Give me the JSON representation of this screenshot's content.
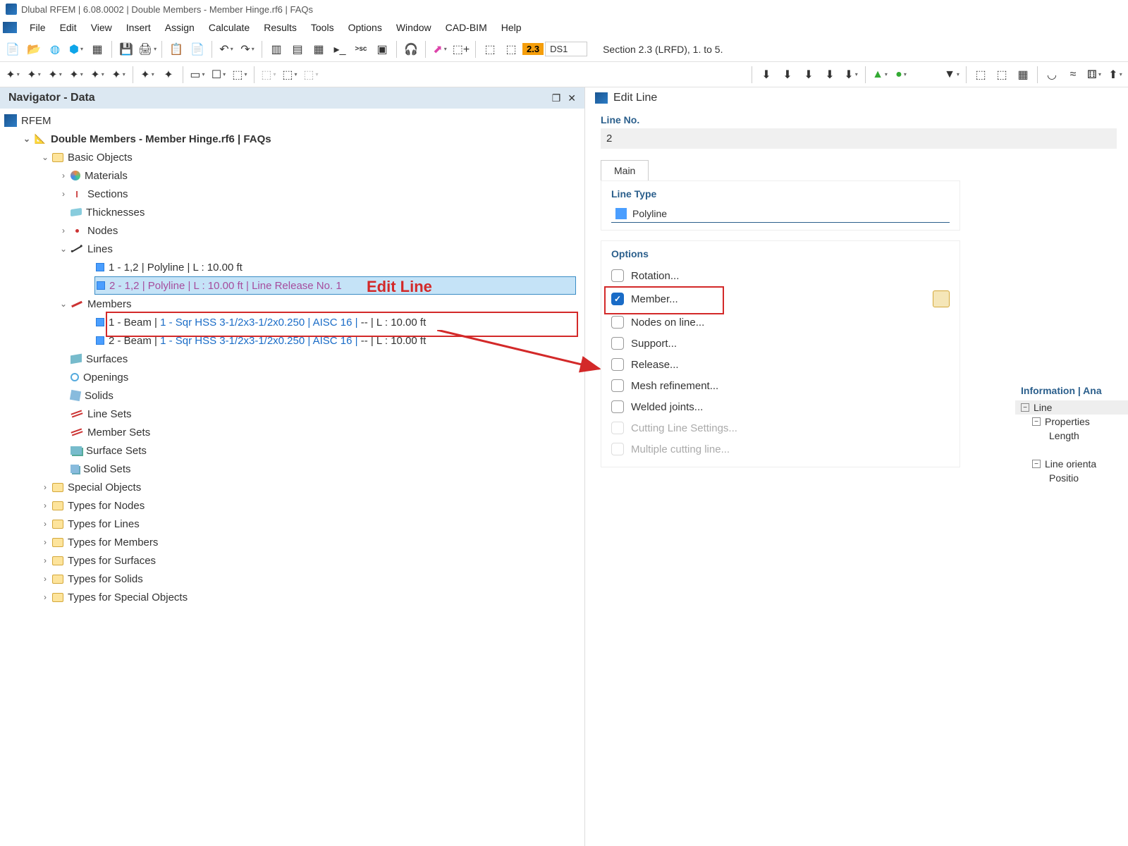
{
  "window_title": "Dlubal RFEM | 6.08.0002 | Double Members - Member Hinge.rf6 | FAQs",
  "menus": [
    "File",
    "Edit",
    "View",
    "Insert",
    "Assign",
    "Calculate",
    "Results",
    "Tools",
    "Options",
    "Window",
    "CAD-BIM",
    "Help"
  ],
  "design": {
    "badge": "2.3",
    "code": "DS1",
    "section": "Section 2.3 (LRFD), 1. to 5."
  },
  "navigator": {
    "title": "Navigator - Data",
    "root": "RFEM",
    "project": "Double Members - Member Hinge.rf6 | FAQs",
    "basic_objects": "Basic Objects",
    "materials": "Materials",
    "sections": "Sections",
    "thicknesses": "Thicknesses",
    "nodes": "Nodes",
    "lines": "Lines",
    "line1": "1 - 1,2 | Polyline | L : 10.00 ft",
    "line2": "2 - 1,2 | Polyline | L : 10.00 ft | Line Release No. 1",
    "members": "Members",
    "member1_a": "1 - Beam | ",
    "member1_b": "1 - Sqr HSS 3-1/2x3-1/2x0.250 | AISC 16 |",
    "member1_c": " -- | L : 10.00 ft",
    "member2_a": "2 - Beam | ",
    "member2_b": "1 - Sqr HSS 3-1/2x3-1/2x0.250 | AISC 16 |",
    "member2_c": " -- | L : 10.00 ft",
    "surfaces": "Surfaces",
    "openings": "Openings",
    "solids": "Solids",
    "line_sets": "Line Sets",
    "member_sets": "Member Sets",
    "surface_sets": "Surface Sets",
    "solid_sets": "Solid Sets",
    "special_objects": "Special Objects",
    "types_nodes": "Types for Nodes",
    "types_lines": "Types for Lines",
    "types_members": "Types for Members",
    "types_surfaces": "Types for Surfaces",
    "types_solids": "Types for Solids",
    "types_special": "Types for Special Objects"
  },
  "annotation": {
    "label": "Edit Line"
  },
  "dialog": {
    "title": "Edit Line",
    "line_no_label": "Line No.",
    "line_no_value": "2",
    "tab_main": "Main",
    "line_type_label": "Line Type",
    "line_type_value": "Polyline",
    "options_label": "Options",
    "options": {
      "rotation": "Rotation...",
      "member": "Member...",
      "nodes_on_line": "Nodes on line...",
      "support": "Support...",
      "release": "Release...",
      "mesh_refinement": "Mesh refinement...",
      "welded_joints": "Welded joints...",
      "cutting_line": "Cutting Line Settings...",
      "multiple_cutting": "Multiple cutting line..."
    }
  },
  "info": {
    "title": "Information | Ana",
    "line": "Line",
    "properties": "Properties",
    "length": "Length",
    "orientation": "Line orienta",
    "position": "Positio"
  }
}
